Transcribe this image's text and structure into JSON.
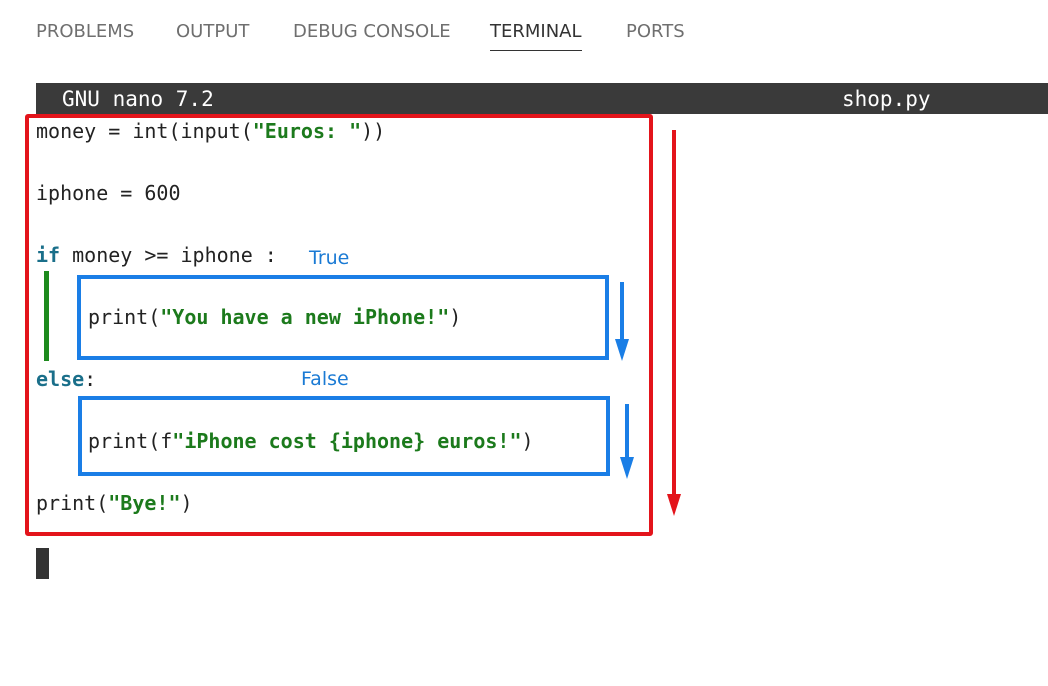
{
  "tabs": [
    {
      "label": "PROBLEMS",
      "active": false
    },
    {
      "label": "OUTPUT",
      "active": false
    },
    {
      "label": "DEBUG CONSOLE",
      "active": false
    },
    {
      "label": "TERMINAL",
      "active": true
    },
    {
      "label": "PORTS",
      "active": false
    }
  ],
  "nano": {
    "version": "GNU nano 7.2",
    "filename": "shop.py"
  },
  "code": {
    "line1": {
      "prefix": "money = int(input(",
      "string": "\"Euros: \"",
      "suffix": "))"
    },
    "line2": {
      "text": "iphone = 600"
    },
    "line3": {
      "keyword": "if",
      "rest": " money >= iphone :"
    },
    "line4": {
      "prefix": "print(",
      "string": "\"You have a new iPhone!\"",
      "suffix": ")"
    },
    "line5": {
      "keyword": "else",
      "rest": ":"
    },
    "line6": {
      "prefix": "print(f",
      "string": "\"iPhone cost {iphone} euros!\"",
      "suffix": ")"
    },
    "line7": {
      "prefix": "print(",
      "string": "\"Bye!\"",
      "suffix": ")"
    }
  },
  "annotations": {
    "true_label": "True",
    "false_label": "False"
  },
  "colors": {
    "outer_box": "#e3141b",
    "branch_boxes": "#1a7ee6",
    "true_bar": "#1d8a1d",
    "keyword": "#1a6f8a",
    "string": "#1c7a1c"
  }
}
